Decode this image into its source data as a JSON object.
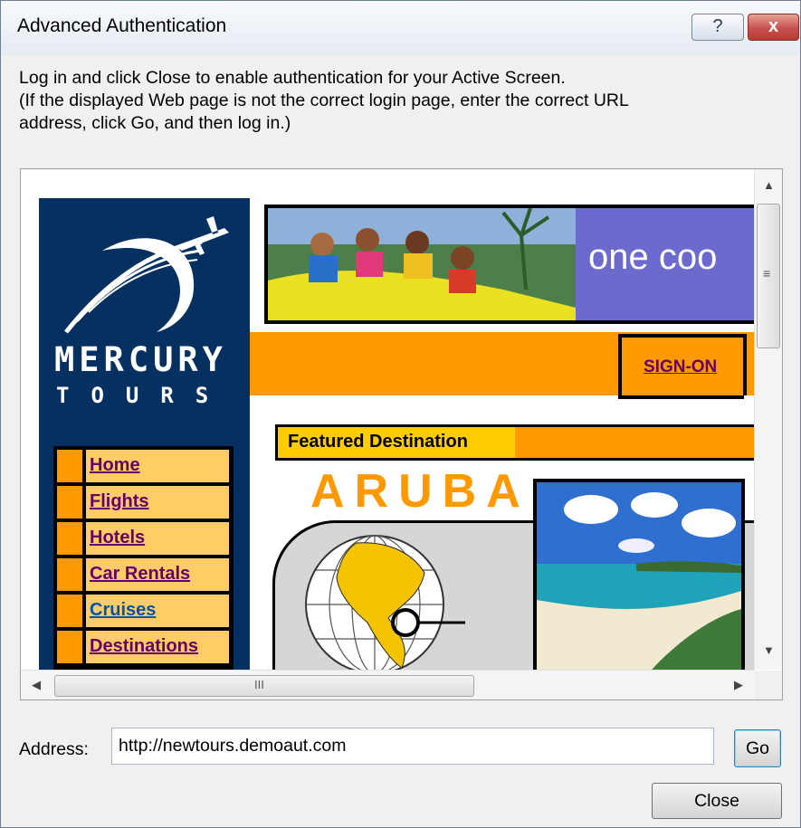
{
  "window": {
    "title": "Advanced Authentication",
    "help_glyph": "?",
    "close_glyph": "x"
  },
  "instructions": {
    "line1": "Log in and click Close to enable authentication for your Active Screen.",
    "line2": "(If the displayed Web page is not the correct login page, enter the correct URL",
    "line3": "address, click Go, and then log in.)"
  },
  "site": {
    "logo_line1": "MERCURY",
    "logo_line2": "TOURS",
    "hero_tagline": "one coo",
    "sign_on": "SIGN-ON",
    "featured_label": "Featured Destination",
    "featured_destination": "ARUBA",
    "nav": [
      {
        "label": "Home"
      },
      {
        "label": "Flights"
      },
      {
        "label": "Hotels"
      },
      {
        "label": "Car Rentals"
      },
      {
        "label": "Cruises"
      },
      {
        "label": "Destinations"
      }
    ]
  },
  "scrollbar": {
    "h_thumb_grip": "III",
    "v_thumb_grip": "≡"
  },
  "address": {
    "label": "Address:",
    "value": "http://newtours.demoaut.com"
  },
  "buttons": {
    "go": "Go",
    "close": "Close"
  },
  "colors": {
    "brand_navy": "#063060",
    "brand_orange": "#ff9900",
    "nav_label_bg": "#ffcc66",
    "link_purple": "#660066",
    "link_blue": "#0055aa",
    "hero_purple": "#6c6acd"
  }
}
